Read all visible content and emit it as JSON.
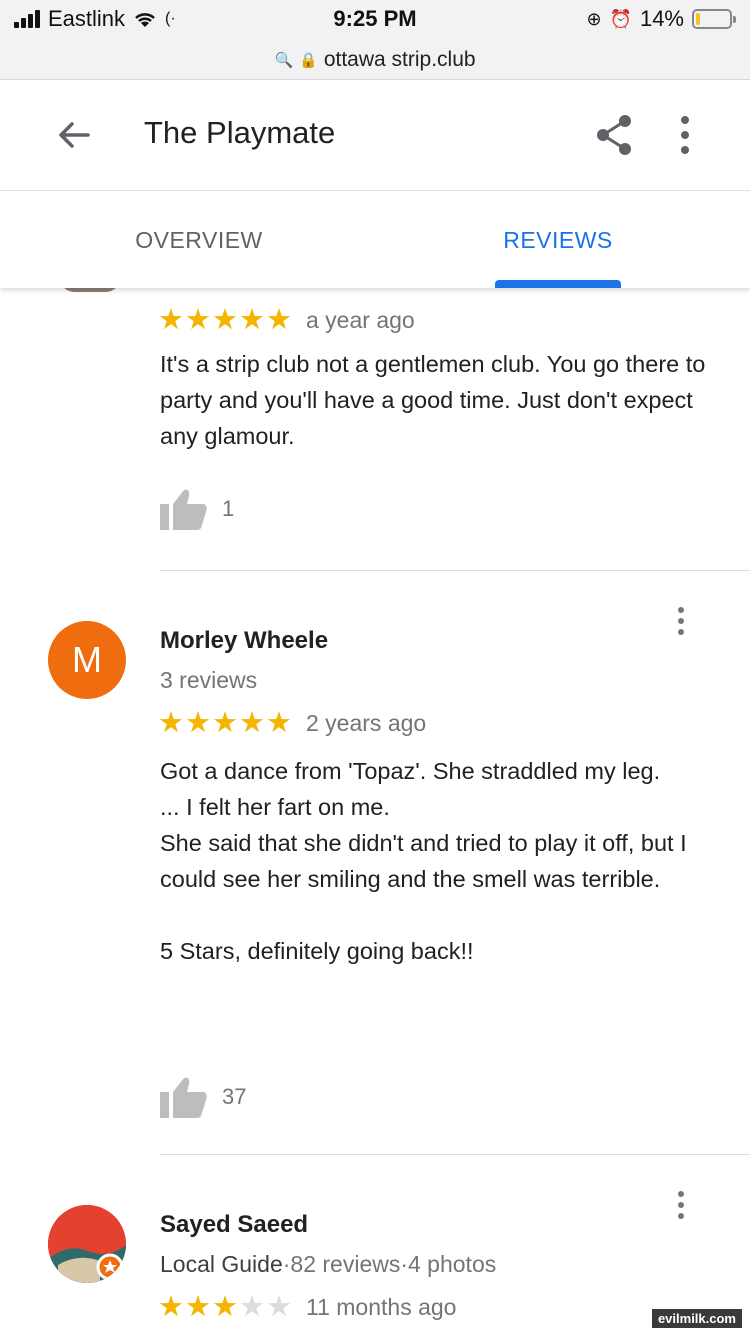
{
  "status_bar": {
    "carrier": "Eastlink",
    "time": "9:25 PM",
    "battery": "14%",
    "battery_level": 0.14,
    "battery_color": "#f4c514"
  },
  "browser": {
    "url": "ottawa strip.club"
  },
  "header": {
    "title": "The Playmate",
    "back_icon": "arrow-back-icon",
    "share_icon": "share-icon",
    "more_icon": "more-vert-icon"
  },
  "tabs": [
    {
      "label": "OVERVIEW",
      "active": false
    },
    {
      "label": "REVIEWS",
      "active": true
    }
  ],
  "colors": {
    "accent": "#1a73e8",
    "star": "#f4b400",
    "avatar_m": "#ef6c0f"
  },
  "reviews": [
    {
      "rating": 5,
      "time": "a year ago",
      "text": "It's a strip club not a gentlemen club. You go there to party and you'll have a good time. Just don't expect any glamour.",
      "likes": "1"
    },
    {
      "avatar_letter": "M",
      "author": "Morley Wheele",
      "meta": "3 reviews",
      "rating": 5,
      "time": "2 years ago",
      "text": "Got a dance from 'Topaz'. She straddled my leg.\n... I felt her fart on me.\nShe said that she didn't and tried to play it off, but I could see her smiling and the smell was terrible.\n\n5 Stars, definitely going back!!",
      "likes": "37"
    },
    {
      "author": "Sayed Saeed",
      "meta_badge": "Local Guide",
      "meta_rest": "·82 reviews·4 photos",
      "rating": 3,
      "time": "11 months ago"
    }
  ],
  "watermark": "evilmilk.com"
}
